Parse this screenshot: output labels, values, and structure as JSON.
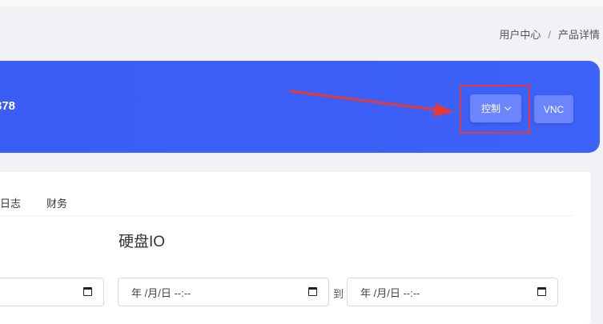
{
  "breadcrumb": {
    "item1": "用户中心",
    "separator": "/",
    "item2": "产品详情"
  },
  "banner": {
    "server_id_fragment": "378",
    "control_label": "控制",
    "vnc_label": "VNC"
  },
  "tabs": {
    "log": "日志",
    "finance": "财务"
  },
  "section": {
    "title": "硬盘IO"
  },
  "date_range": {
    "placeholder": "年 /月/日 --:--",
    "to_label": "到"
  },
  "colors": {
    "banner": "#3b5ff6",
    "button": "#6c85ff",
    "highlight": "#e53935"
  }
}
